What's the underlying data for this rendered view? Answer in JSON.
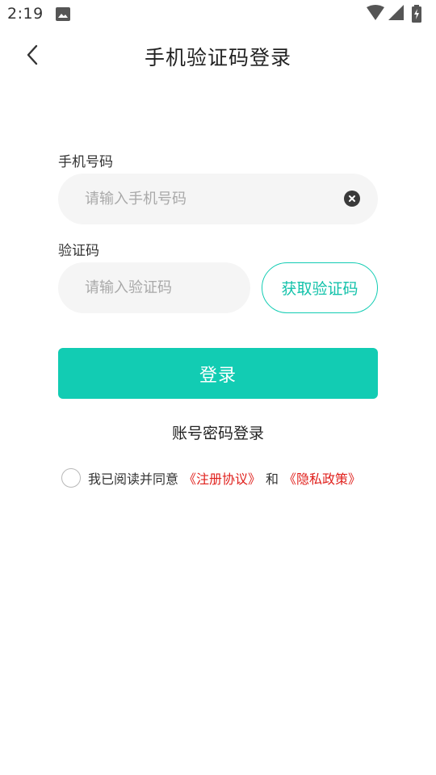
{
  "status_bar": {
    "time": "2:19",
    "icons": [
      "image-icon",
      "wifi-icon",
      "cell-signal-icon",
      "battery-charging-icon"
    ]
  },
  "header": {
    "back_icon": "chevron-left-icon",
    "title": "手机验证码登录"
  },
  "form": {
    "phone_label": "手机号码",
    "phone_placeholder": "请输入手机号码",
    "phone_value": "",
    "clear_icon": "close-circle-icon",
    "code_label": "验证码",
    "code_placeholder": "请输入验证码",
    "code_value": "",
    "get_code_label": "获取验证码",
    "login_label": "登录"
  },
  "account_login_link": "账号密码登录",
  "agreement": {
    "checked": false,
    "text": "我已阅读并同意",
    "terms_link": "《注册协议》",
    "and_text": "和",
    "privacy_link": "《隐私政策》"
  },
  "colors": {
    "accent": "#12ccb3",
    "link_red": "#e0201c",
    "input_bg": "#f5f5f5"
  }
}
